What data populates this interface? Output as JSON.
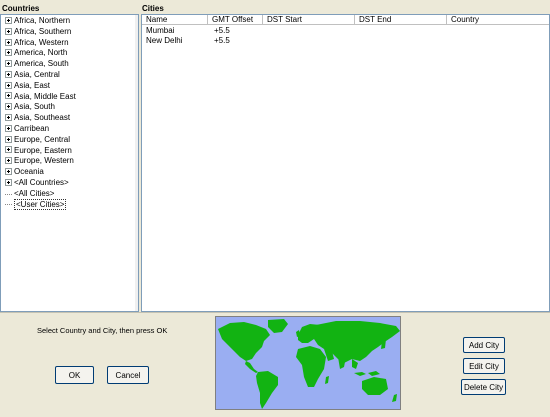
{
  "countries_pane": {
    "title": "Countries",
    "items": [
      {
        "label": "Africa, Northern",
        "kind": "expandable"
      },
      {
        "label": "Africa, Southern",
        "kind": "expandable"
      },
      {
        "label": "Africa, Western",
        "kind": "expandable"
      },
      {
        "label": "America, North",
        "kind": "expandable"
      },
      {
        "label": "America, South",
        "kind": "expandable"
      },
      {
        "label": "Asia, Central",
        "kind": "expandable"
      },
      {
        "label": "Asia, East",
        "kind": "expandable"
      },
      {
        "label": "Asia, Middle East",
        "kind": "expandable"
      },
      {
        "label": "Asia, South",
        "kind": "expandable"
      },
      {
        "label": "Asia, Southeast",
        "kind": "expandable"
      },
      {
        "label": "Carribean",
        "kind": "expandable"
      },
      {
        "label": "Europe, Central",
        "kind": "expandable"
      },
      {
        "label": "Europe, Eastern",
        "kind": "expandable"
      },
      {
        "label": "Europe, Western",
        "kind": "expandable"
      },
      {
        "label": "Oceania",
        "kind": "expandable"
      },
      {
        "label": "<All Countries>",
        "kind": "expandable"
      },
      {
        "label": "<All Cities>",
        "kind": "leaf"
      },
      {
        "label": "<User Cities>",
        "kind": "leaf",
        "selected": true
      }
    ]
  },
  "cities_pane": {
    "title": "Cities",
    "columns": [
      "Name",
      "GMT Offset",
      "DST Start",
      "DST End",
      "Country"
    ],
    "rows": [
      {
        "name": "Mumbai",
        "gmt_offset": "+5.5",
        "dst_start": "",
        "dst_end": "",
        "country": ""
      },
      {
        "name": "New Delhi",
        "gmt_offset": "+5.5",
        "dst_start": "",
        "dst_end": "",
        "country": ""
      }
    ]
  },
  "footer": {
    "instruction": "Select Country and City, then press OK",
    "ok_label": "OK",
    "cancel_label": "Cancel",
    "add_city_label": "Add City",
    "edit_city_label": "Edit City",
    "delete_city_label": "Delete City"
  },
  "colors": {
    "map_ocean": "#9aaef2",
    "map_land": "#12b312",
    "window_bg": "#ece9d8"
  }
}
